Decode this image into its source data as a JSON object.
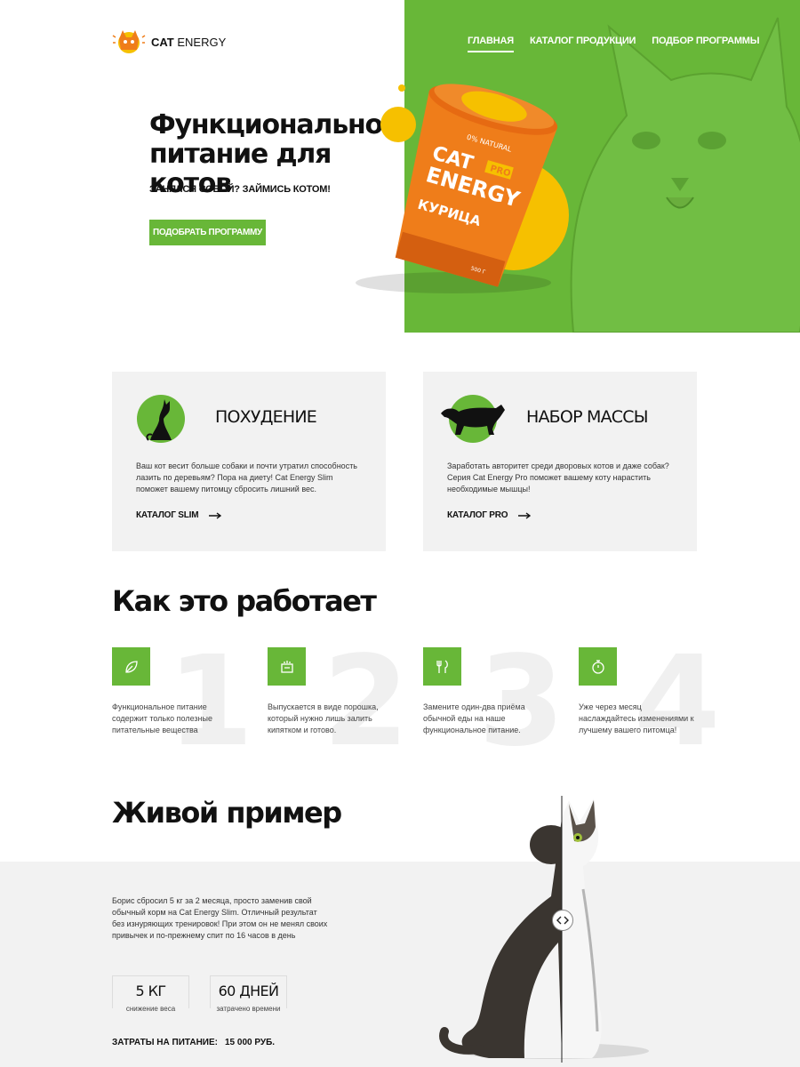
{
  "brand": {
    "name_bold": "CAT",
    "name_rest": " ENERGY"
  },
  "nav": {
    "items": [
      "ГЛАВНАЯ",
      "КАТАЛОГ ПРОДУКЦИИ",
      "ПОДБОР ПРОГРАММЫ"
    ],
    "active_index": 0
  },
  "hero": {
    "title": "Функциональное питание для котов",
    "subtitle": "ЗАНЯЛСЯ СОБОЙ? ЗАЙМИСЬ КОТОМ!",
    "button": "ПОДОБРАТЬ ПРОГРАММУ",
    "package": {
      "badge": "0% NATURAL",
      "line1": "CAT",
      "line2": "ENERGY",
      "tag": "PRO",
      "flavor": "КУРИЦА",
      "weight": "500 Г"
    }
  },
  "cards": [
    {
      "title": "ПОХУДЕНИЕ",
      "text": "Ваш кот весит больше собаки и почти утратил способность лазить по деревьям? Пора на диету! Cat Energy Slim поможет вашему питомцу сбросить лишний вес.",
      "link": "КАТАЛОГ SLIM"
    },
    {
      "title": "НАБОР МАССЫ",
      "text": "Заработать авторитет среди дворовых котов и даже собак? Серия Cat Energy Pro поможет вашему коту нарастить необходимые мышцы!",
      "link": "КАТАЛОГ PRO"
    }
  ],
  "how": {
    "title": "Как это работает",
    "steps": [
      {
        "num": "1",
        "text": "Функциональное питание содержит только полезные питательные вещества",
        "icon": "leaf-icon"
      },
      {
        "num": "2",
        "text": "Выпускается в виде порошка, который нужно лишь залить кипятком и готово.",
        "icon": "kettle-icon"
      },
      {
        "num": "3",
        "text": "Замените один-два приёма обычной еды на наше функциональное питание.",
        "icon": "cutlery-icon"
      },
      {
        "num": "4",
        "text": "Уже через месяц наслаждайтесь изменениями к лучшему вашего питомца!",
        "icon": "stopwatch-icon"
      }
    ]
  },
  "example": {
    "title": "Живой пример",
    "text": "Борис сбросил 5 кг за 2 месяца, просто заменив свой обычный корм на Cat Energy Slim. Отличный результат без изнуряющих тренировок! При этом он не менял своих привычек и по-прежнему спит по 16 часов в день",
    "stats": [
      {
        "value": "5 КГ",
        "caption": "снижение веса"
      },
      {
        "value": "60 ДНЕЙ",
        "caption": "затрачено времени"
      }
    ],
    "cost_label": "ЗАТРАТЫ НА ПИТАНИЕ:",
    "cost_value": "15 000 РУБ."
  },
  "colors": {
    "accent": "#68b738",
    "yellow": "#f6c000",
    "orange": "#ef7d1a",
    "panel": "#f2f2f2"
  }
}
